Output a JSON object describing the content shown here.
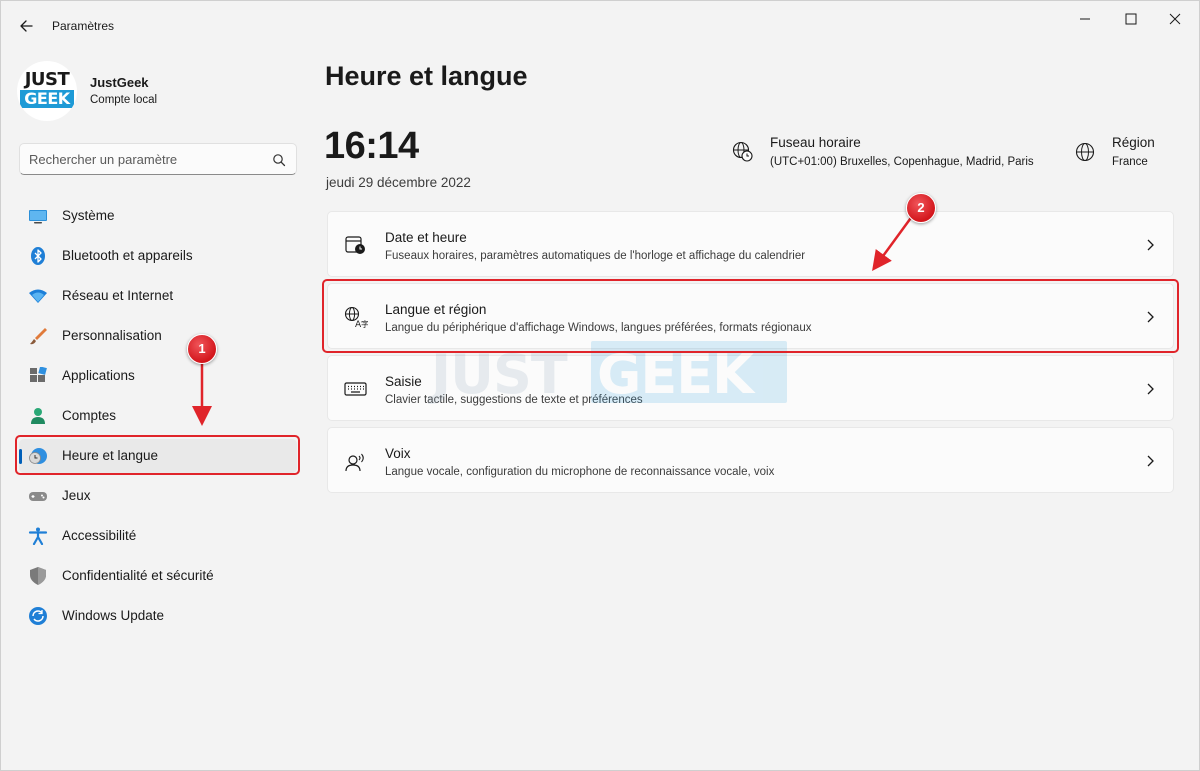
{
  "app": {
    "title": "Paramètres"
  },
  "profile": {
    "logo_top": "JUST",
    "logo_bottom": "GEEK",
    "name": "JustGeek",
    "account_type": "Compte local"
  },
  "search": {
    "placeholder": "Rechercher un paramètre"
  },
  "sidebar": {
    "items": [
      {
        "label": "Système",
        "icon": "monitor-icon"
      },
      {
        "label": "Bluetooth et appareils",
        "icon": "bluetooth-icon"
      },
      {
        "label": "Réseau et Internet",
        "icon": "wifi-icon"
      },
      {
        "label": "Personnalisation",
        "icon": "brush-icon"
      },
      {
        "label": "Applications",
        "icon": "apps-icon"
      },
      {
        "label": "Comptes",
        "icon": "person-icon"
      },
      {
        "label": "Heure et langue",
        "icon": "globe-clock-icon",
        "active": true
      },
      {
        "label": "Jeux",
        "icon": "gamepad-icon"
      },
      {
        "label": "Accessibilité",
        "icon": "accessibility-icon"
      },
      {
        "label": "Confidentialité et sécurité",
        "icon": "shield-icon"
      },
      {
        "label": "Windows Update",
        "icon": "update-icon"
      }
    ]
  },
  "main": {
    "title": "Heure et langue",
    "time": "16:14",
    "date": "jeudi 29 décembre 2022",
    "timezone": {
      "title": "Fuseau horaire",
      "value": "(UTC+01:00) Bruxelles, Copenhague, Madrid, Paris"
    },
    "region": {
      "title": "Région",
      "value": "France"
    },
    "cards": [
      {
        "title": "Date et heure",
        "desc": "Fuseaux horaires, paramètres automatiques de l'horloge et affichage du calendrier",
        "icon": "calendar-clock-icon"
      },
      {
        "title": "Langue et région",
        "desc": "Langue du périphérique d'affichage Windows, langues préférées, formats régionaux",
        "icon": "language-icon"
      },
      {
        "title": "Saisie",
        "desc": "Clavier tactile, suggestions de texte et préférences",
        "icon": "keyboard-icon"
      },
      {
        "title": "Voix",
        "desc": "Langue vocale, configuration du microphone de reconnaissance vocale, voix",
        "icon": "speech-icon"
      }
    ]
  },
  "watermark": {
    "part1": "JUST",
    "part2": "GEEK"
  },
  "annotations": {
    "step1": "1",
    "step2": "2"
  },
  "colors": {
    "accent": "#005fb8",
    "annotation": "#e0242a",
    "background": "#f3f3f3",
    "card": "#fbfbfb"
  }
}
